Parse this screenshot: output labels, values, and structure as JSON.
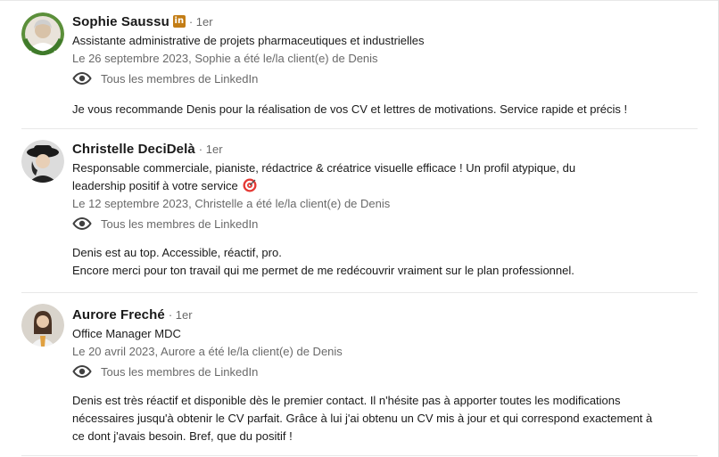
{
  "recommendations": [
    {
      "name": "Sophie Saussu",
      "linkedin_badge": "in",
      "degree": "· 1er",
      "headline": "Assistante administrative de projets pharmaceutiques et industrielles",
      "date": "Le 26 septembre 2023, Sophie a été le/la client(e) de Denis",
      "visibility": "Tous les membres de LinkedIn",
      "text": "Je vous recommande Denis pour la réalisation de vos CV et lettres de motivations. Service rapide et précis !"
    },
    {
      "name": "Christelle DeciDelà",
      "degree": "· 1er",
      "headline_line1": "Responsable commerciale, pianiste, rédactrice & créatrice visuelle efficace ! Un profil atypique, du",
      "headline_line2": "leadership positif à votre service",
      "headline_emoji": "target-emoji",
      "date": "Le 12 septembre 2023, Christelle a été le/la client(e) de Denis",
      "visibility": "Tous les membres de LinkedIn",
      "text_line1": "Denis est au top. Accessible, réactif, pro.",
      "text_line2": "Encore merci pour ton travail qui me permet de me redécouvrir vraiment sur le plan professionnel."
    },
    {
      "name": "Aurore Freché",
      "degree": "· 1er",
      "headline": "Office Manager MDC",
      "date": "Le 20 avril 2023, Aurore a été le/la client(e) de Denis",
      "visibility": "Tous les membres de LinkedIn",
      "text_line1": "Denis est très réactif et disponible dès le premier contact. Il n'hésite pas à apporter toutes les modifications",
      "text_line2": "nécessaires jusqu'à obtenir le CV parfait. Grâce à lui j'ai obtenu un CV mis à jour et qui correspond exactement à",
      "text_line3": "ce dont j'avais besoin. Bref, que du positif !"
    }
  ],
  "colors": {
    "badge": "#c37d16",
    "muted_text": "rgba(0,0,0,0.6)",
    "separator": "#e8e8e8"
  }
}
